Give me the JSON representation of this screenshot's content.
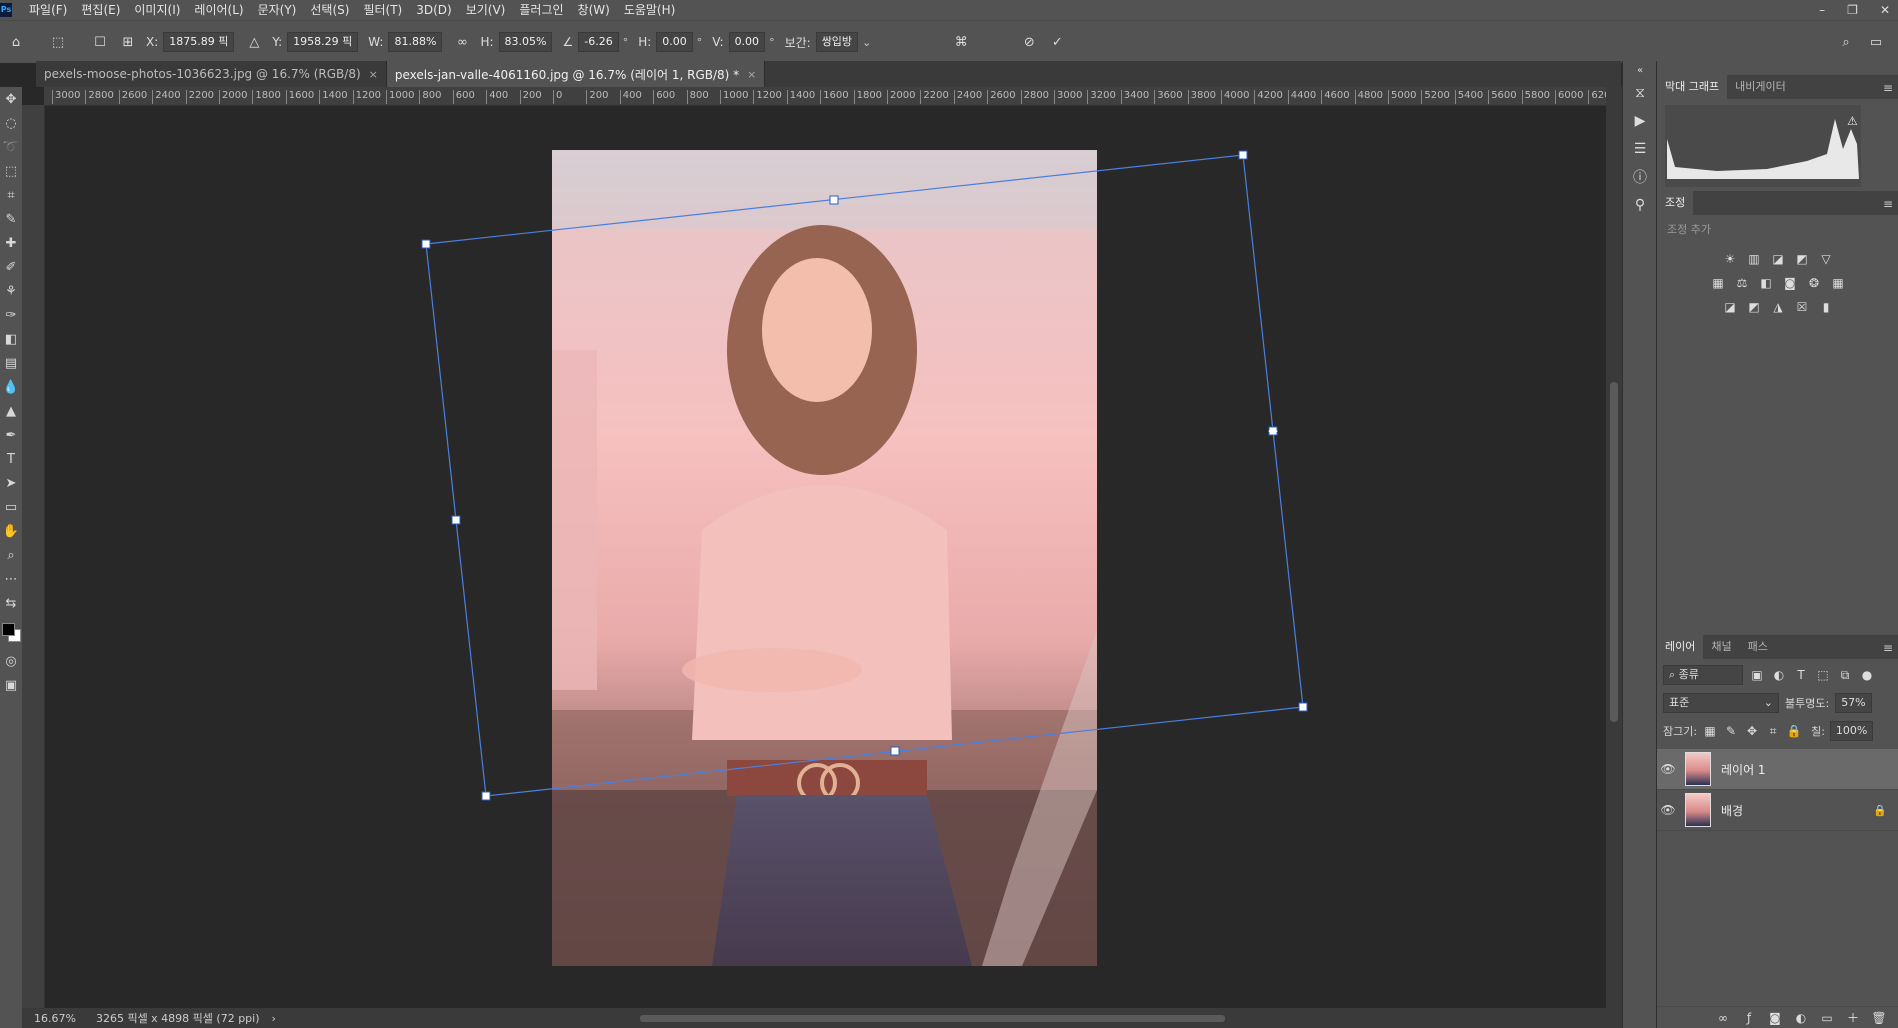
{
  "app": {
    "logo": "Ps"
  },
  "menu": [
    "파일(F)",
    "편집(E)",
    "이미지(I)",
    "레이어(L)",
    "문자(Y)",
    "선택(S)",
    "필터(T)",
    "3D(D)",
    "보기(V)",
    "플러그인",
    "창(W)",
    "도움말(H)"
  ],
  "options": {
    "x_label": "X:",
    "x_value": "1875.89 픽",
    "y_label": "Y:",
    "y_value": "1958.29 픽",
    "w_label": "W:",
    "w_value": "81.88%",
    "h_label": "H:",
    "h_value": "83.05%",
    "angle_value": "-6.26",
    "angle_unit": "°",
    "hskew_label": "H:",
    "hskew_value": "0.00",
    "hskew_unit": "°",
    "vskew_label": "V:",
    "vskew_value": "0.00",
    "vskew_unit": "°",
    "interp_label": "보간:",
    "interp_value": "쌍입방",
    "cancel_glyph": "⊘",
    "commit_glyph": "✓"
  },
  "tabs": [
    {
      "label": "pexels-moose-photos-1036623.jpg @ 16.7% (RGB/8)",
      "close": "×"
    },
    {
      "label": "pexels-jan-valle-4061160.jpg @ 16.7% (레이어 1, RGB/8) *",
      "close": "×"
    }
  ],
  "ruler_ticks": [
    "3000",
    "2800",
    "2600",
    "2400",
    "2200",
    "2000",
    "1800",
    "1600",
    "1400",
    "1200",
    "1000",
    "800",
    "600",
    "400",
    "200",
    "0",
    "200",
    "400",
    "600",
    "800",
    "1000",
    "1200",
    "1400",
    "1600",
    "1800",
    "2000",
    "2200",
    "2400",
    "2600",
    "2800",
    "3000",
    "3200",
    "3400",
    "3600",
    "3800",
    "4000",
    "4200",
    "4400",
    "4600",
    "4800",
    "5000",
    "5200",
    "5400",
    "5600",
    "5800",
    "6000",
    "620"
  ],
  "status": {
    "zoom": "16.67%",
    "doc_info": "3265 픽셀 x 4898 픽셀 (72 ppi)",
    "arrow": "›"
  },
  "panels": {
    "top_tabs": [
      "막대 그래프",
      "내비게이터"
    ],
    "adjust_tab": "조정",
    "adjust_add": "조정 추가",
    "layer_tabs": [
      "레이어",
      "채널",
      "패스"
    ],
    "kind_placeholder": "종류",
    "blend_mode": "표준",
    "opacity_label": "불투명도:",
    "opacity_value": "57%",
    "lock_label": "잠그기:",
    "fill_label": "칠:",
    "fill_value": "100%",
    "layers": [
      {
        "name": "레이어 1",
        "selected": true,
        "locked": false
      },
      {
        "name": "배경",
        "selected": false,
        "locked": true
      }
    ]
  },
  "icons": {
    "move": "move-icon",
    "marquee": "marquee-icon",
    "lasso": "lasso-icon",
    "crop": "crop-icon",
    "brush": "brush-icon",
    "type": "type-icon",
    "zoom": "zoom-icon"
  }
}
